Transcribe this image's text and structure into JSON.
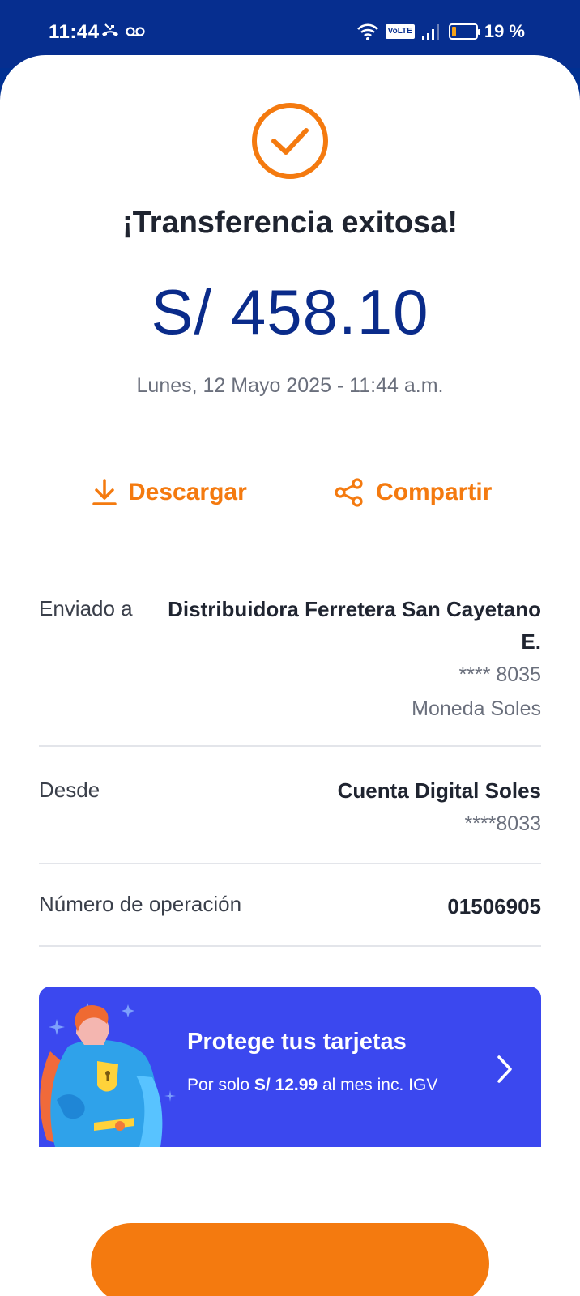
{
  "status_bar": {
    "time": "11:44",
    "volte": "VoLTE",
    "battery": "19 %",
    "battery_level": 0.19
  },
  "receipt": {
    "title": "¡Transferencia exitosa!",
    "amount": "S/ 458.10",
    "datetime": "Lunes, 12 Mayo 2025 - 11:44 a.m."
  },
  "actions": {
    "download_label": "Descargar",
    "share_label": "Compartir"
  },
  "details": {
    "sent_to_label": "Enviado a",
    "sent_to_name": "Distribuidora Ferretera San Cayetano E.",
    "sent_to_account": "**** 8035",
    "sent_to_currency": "Moneda Soles",
    "from_label": "Desde",
    "from_account_name": "Cuenta Digital Soles",
    "from_account_number": "****8033",
    "operation_label": "Número de operación",
    "operation_number": "01506905"
  },
  "promo": {
    "title": "Protege tus tarjetas",
    "text_prefix": "Por solo ",
    "price": "S/ 12.99",
    "text_suffix": " al mes inc. IGV"
  },
  "colors": {
    "brand_blue": "#0a2b8a",
    "accent_orange": "#f47a0f",
    "promo_blue": "#3b48ef"
  }
}
